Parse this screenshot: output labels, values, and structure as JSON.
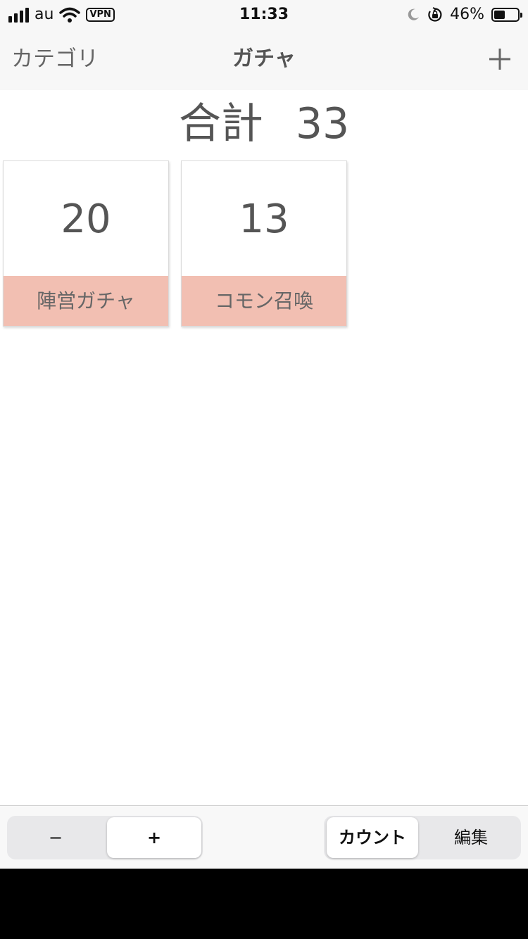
{
  "status_bar": {
    "carrier": "au",
    "vpn": "VPN",
    "time": "11:33",
    "battery_percent_text": "46%",
    "battery_level": 0.46,
    "icons": [
      "signal-icon",
      "wifi-icon",
      "vpn-badge",
      "moon-icon",
      "orientation-lock-icon",
      "battery-icon"
    ]
  },
  "nav": {
    "back_label": "カテゴリ",
    "title": "ガチャ",
    "add_icon": "plus-icon"
  },
  "total": {
    "label": "合計",
    "value": "33"
  },
  "cards": [
    {
      "count": "20",
      "label": "陣営ガチャ"
    },
    {
      "count": "13",
      "label": "コモン召喚"
    }
  ],
  "toolbar": {
    "stepper": {
      "minus_label": "−",
      "plus_label": "+",
      "selected": "plus"
    },
    "mode": {
      "count_label": "カウント",
      "edit_label": "編集",
      "selected": "count"
    }
  },
  "colors": {
    "card_label_bg": "#f2bfb2",
    "bar_bg": "#f7f7f7",
    "text": "#555555"
  }
}
